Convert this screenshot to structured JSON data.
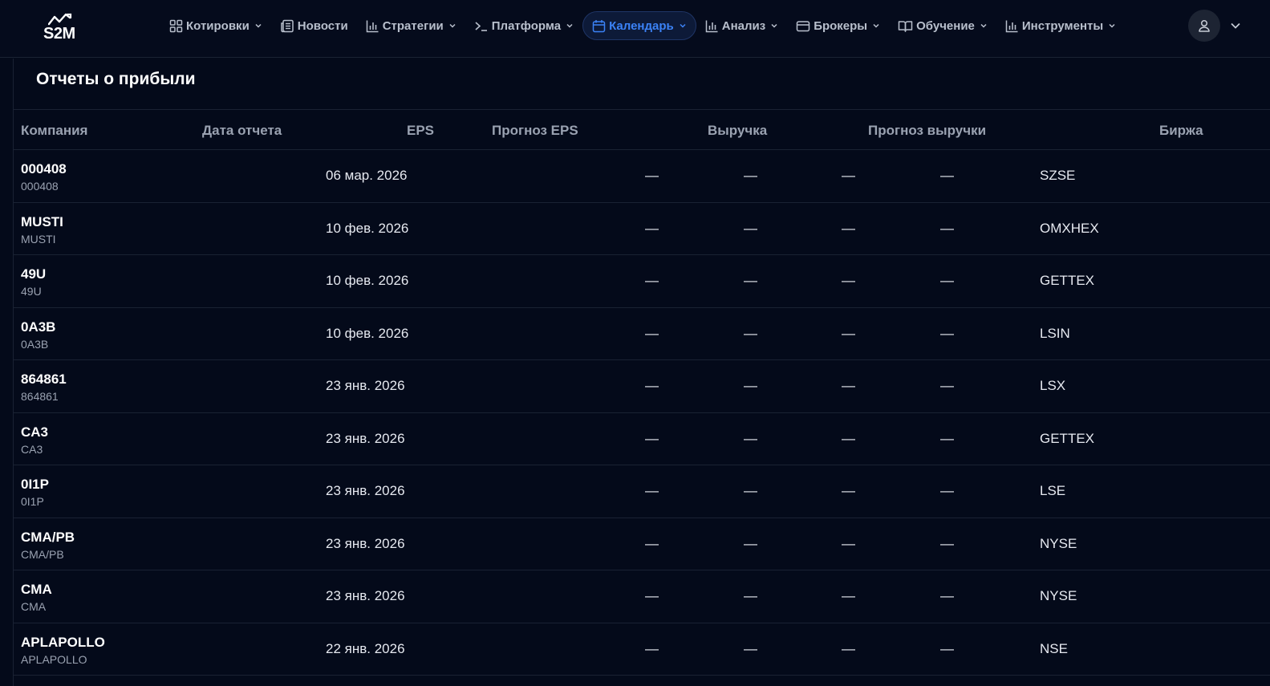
{
  "brand": {
    "logo_text": "S2M"
  },
  "nav": [
    {
      "label": "Котировки",
      "icon": "grid-icon",
      "dropdown": true,
      "active": false
    },
    {
      "label": "Новости",
      "icon": "newspaper-icon",
      "dropdown": false,
      "active": false
    },
    {
      "label": "Стратегии",
      "icon": "bar-chart-icon",
      "dropdown": true,
      "active": false
    },
    {
      "label": "Платформа",
      "icon": "terminal-icon",
      "dropdown": true,
      "active": false
    },
    {
      "label": "Календарь",
      "icon": "calendar-icon",
      "dropdown": true,
      "active": true
    },
    {
      "label": "Анализ",
      "icon": "bar-chart-icon",
      "dropdown": true,
      "active": false
    },
    {
      "label": "Брокеры",
      "icon": "wallet-icon",
      "dropdown": true,
      "active": false
    },
    {
      "label": "Обучение",
      "icon": "book-icon",
      "dropdown": true,
      "active": false
    },
    {
      "label": "Инструменты",
      "icon": "bar-chart-icon",
      "dropdown": true,
      "active": false
    }
  ],
  "colors": {
    "accent": "#3b82f6",
    "background": "#040a1a",
    "muted": "#9aa2b1"
  },
  "page": {
    "title": "Отчеты о прибыли"
  },
  "table": {
    "headers": {
      "company": "Компания",
      "report_date": "Дата отчета",
      "eps": "EPS",
      "eps_forecast": "Прогноз EPS",
      "revenue": "Выручка",
      "revenue_forecast": "Прогноз выручки",
      "exchange": "Биржа"
    },
    "rows": [
      {
        "ticker": "000408",
        "name": "000408",
        "date": "06 мар. 2026",
        "eps": "—",
        "eps_forecast": "—",
        "revenue": "—",
        "revenue_forecast": "—",
        "exchange": "SZSE"
      },
      {
        "ticker": "MUSTI",
        "name": "MUSTI",
        "date": "10 фев. 2026",
        "eps": "—",
        "eps_forecast": "—",
        "revenue": "—",
        "revenue_forecast": "—",
        "exchange": "OMXHEX"
      },
      {
        "ticker": "49U",
        "name": "49U",
        "date": "10 фев. 2026",
        "eps": "—",
        "eps_forecast": "—",
        "revenue": "—",
        "revenue_forecast": "—",
        "exchange": "GETTEX"
      },
      {
        "ticker": "0A3B",
        "name": "0A3B",
        "date": "10 фев. 2026",
        "eps": "—",
        "eps_forecast": "—",
        "revenue": "—",
        "revenue_forecast": "—",
        "exchange": "LSIN"
      },
      {
        "ticker": "864861",
        "name": "864861",
        "date": "23 янв. 2026",
        "eps": "—",
        "eps_forecast": "—",
        "revenue": "—",
        "revenue_forecast": "—",
        "exchange": "LSX"
      },
      {
        "ticker": "CA3",
        "name": "CA3",
        "date": "23 янв. 2026",
        "eps": "—",
        "eps_forecast": "—",
        "revenue": "—",
        "revenue_forecast": "—",
        "exchange": "GETTEX"
      },
      {
        "ticker": "0I1P",
        "name": "0I1P",
        "date": "23 янв. 2026",
        "eps": "—",
        "eps_forecast": "—",
        "revenue": "—",
        "revenue_forecast": "—",
        "exchange": "LSE"
      },
      {
        "ticker": "CMA/PB",
        "name": "CMA/PB",
        "date": "23 янв. 2026",
        "eps": "—",
        "eps_forecast": "—",
        "revenue": "—",
        "revenue_forecast": "—",
        "exchange": "NYSE"
      },
      {
        "ticker": "CMA",
        "name": "CMA",
        "date": "23 янв. 2026",
        "eps": "—",
        "eps_forecast": "—",
        "revenue": "—",
        "revenue_forecast": "—",
        "exchange": "NYSE"
      },
      {
        "ticker": "APLAPOLLO",
        "name": "APLAPOLLO",
        "date": "22 янв. 2026",
        "eps": "—",
        "eps_forecast": "—",
        "revenue": "—",
        "revenue_forecast": "—",
        "exchange": "NSE"
      }
    ]
  }
}
